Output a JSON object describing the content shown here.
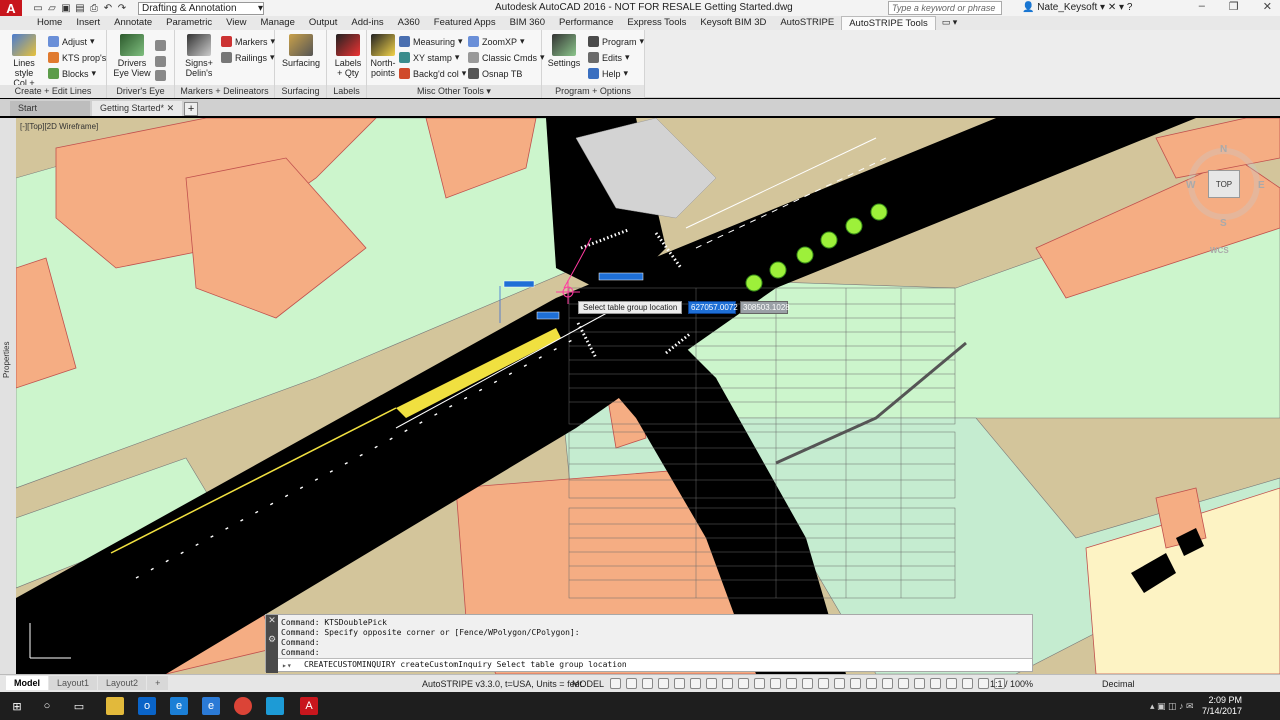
{
  "titlebar": {
    "workspace": "Drafting & Annotation",
    "title": "Autodesk AutoCAD 2016 - NOT FOR RESALE    Getting Started.dwg",
    "search_placeholder": "Type a keyword or phrase",
    "user": "Nate_Keysoft"
  },
  "tabs": [
    "Home",
    "Insert",
    "Annotate",
    "Parametric",
    "View",
    "Manage",
    "Output",
    "Add-ins",
    "A360",
    "Featured Apps",
    "BIM 360",
    "Performance",
    "Express Tools",
    "Keysoft BIM 3D",
    "AutoSTRIPE",
    "AutoSTRIPE Tools"
  ],
  "ribbon": {
    "panels": [
      {
        "title": "Create + Edit Lines",
        "big": "Lines style\nCol + layer",
        "small": [
          "Adjust",
          "KTS prop's",
          "Blocks"
        ]
      },
      {
        "title": "Driver's Eye View",
        "big": "Drivers\nEye View"
      },
      {
        "title": "Markers + Delineators",
        "big": "Signs+\nDelin's",
        "small": [
          "Markers",
          "Railings"
        ]
      },
      {
        "title": "Surfacing",
        "big": "Surfacing"
      },
      {
        "title": "Labels",
        "big": "Labels\n+ Qty"
      },
      {
        "title": "Misc Other Tools",
        "big": "North-\npoints",
        "small": [
          "Measuring",
          "XY stamp",
          "Backg'd col",
          "ZoomXP",
          "Classic Cmds",
          "Osnap TB"
        ]
      },
      {
        "title": "Program + Options",
        "big": "Settings",
        "small": [
          "Program",
          "Edits",
          "Help"
        ]
      }
    ]
  },
  "doctabs": {
    "start": "Start",
    "active": "Getting Started*"
  },
  "viewport_label": "[-][Top][2D Wireframe]",
  "viewcube": {
    "top": "TOP",
    "n": "N",
    "w": "W",
    "e": "E",
    "s": "S",
    "wcs": "WCS"
  },
  "side_palette": "Properties",
  "tooltip": "Select table group location",
  "coord_x": "627057.0072",
  "coord_y": "308503.1028",
  "command": {
    "history": [
      "Command: KTSDoublePick",
      "Command: Specify opposite corner or [Fence/WPolygon/CPolygon]:",
      "Command:",
      "Command:"
    ],
    "prompt": "CREATECUSTOMINQUIRY createCustomInquiry Select table group location"
  },
  "statusbar": {
    "tabs": [
      "Model",
      "Layout1",
      "Layout2"
    ],
    "version": "AutoSTRIPE v3.3.0, t=USA, Units = feet.",
    "model": "MODEL",
    "scale": "1:1 / 100%",
    "units": "Decimal"
  },
  "taskbar": {
    "time": "2:09 PM",
    "date": "7/14/2017"
  },
  "colors": {
    "road": "#000000",
    "building": "#f5ad83",
    "verge": "#ccf5cc",
    "land": "#d3c59b",
    "highlight": "#1e6fd6",
    "autocad_red": "#c8161d"
  }
}
